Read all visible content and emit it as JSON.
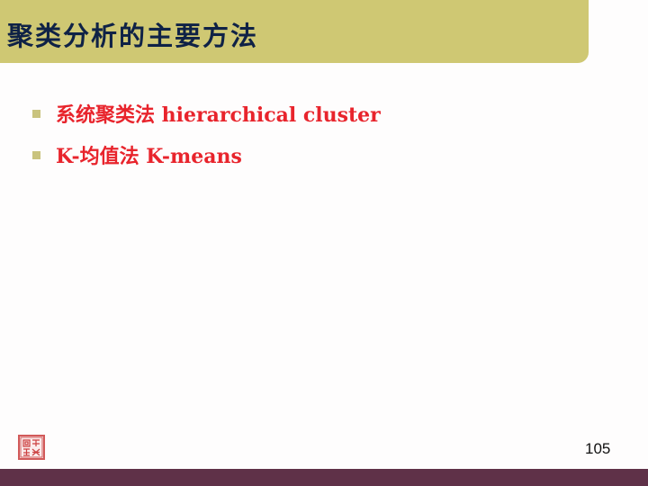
{
  "slide": {
    "title": "聚类分析的主要方法",
    "bullets": [
      {
        "text": "系统聚类法 hierarchical cluster"
      },
      {
        "text": "K-均值法 K-means"
      }
    ],
    "page_number": "105"
  },
  "colors": {
    "title_bar": "#cfc873",
    "title_text": "#0f2246",
    "bullet_text": "#e8242c",
    "bullet_marker": "#c9c37e",
    "bottom_bar": "#5f3148",
    "seal": "#d25a5a"
  },
  "icons": {
    "bullet": "square-bullet-icon",
    "logo": "seal-logo-icon"
  }
}
